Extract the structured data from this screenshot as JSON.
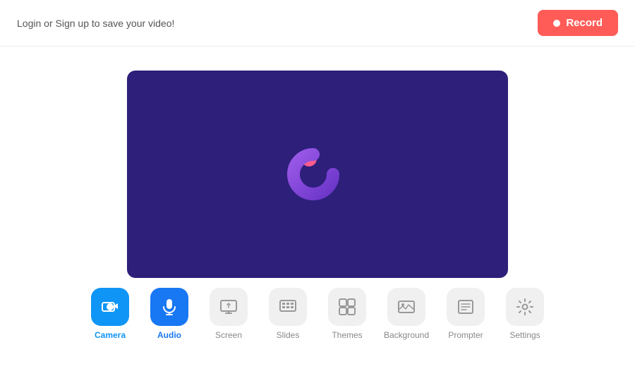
{
  "header": {
    "login_text": "Login",
    "or_text": " or ",
    "signup_text": "Sign up",
    "save_text": " to save your video!",
    "record_label": "Record"
  },
  "preview": {
    "bg_color": "#2d1f7a"
  },
  "toolbar": {
    "items": [
      {
        "id": "camera",
        "label": "Camera",
        "active": true,
        "active_type": "camera"
      },
      {
        "id": "audio",
        "label": "Audio",
        "active": true,
        "active_type": "audio"
      },
      {
        "id": "screen",
        "label": "Screen",
        "active": false
      },
      {
        "id": "slides",
        "label": "Slides",
        "active": false
      },
      {
        "id": "themes",
        "label": "Themes",
        "active": false
      },
      {
        "id": "background",
        "label": "Background",
        "active": false
      },
      {
        "id": "prompter",
        "label": "Prompter",
        "active": false
      },
      {
        "id": "settings",
        "label": "Settings",
        "active": false
      }
    ]
  }
}
